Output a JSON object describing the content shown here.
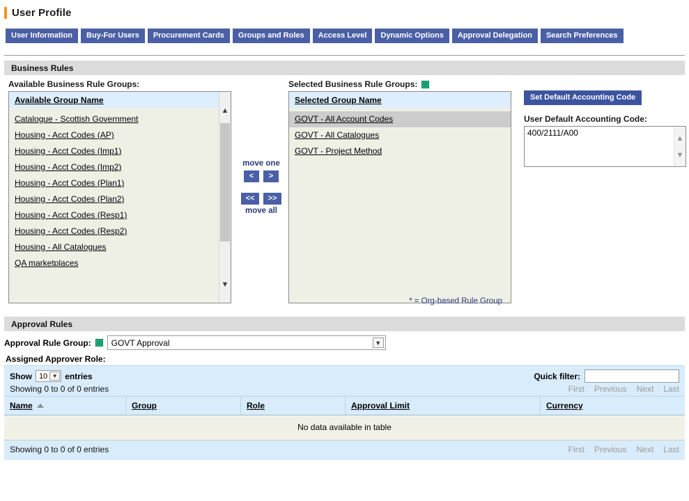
{
  "header": {
    "title": "User Profile"
  },
  "tabs": [
    {
      "label": "User Information"
    },
    {
      "label": "Buy-For Users"
    },
    {
      "label": "Procurement Cards"
    },
    {
      "label": "Groups and Roles"
    },
    {
      "label": "Access Level"
    },
    {
      "label": "Dynamic Options"
    },
    {
      "label": "Approval Delegation"
    },
    {
      "label": "Search Preferences"
    }
  ],
  "business_rules": {
    "section_title": "Business Rules",
    "available_label": "Available Business Rule Groups:",
    "available_header": "Available Group Name",
    "available_items": [
      "Catalogue - Scottish Government",
      "Housing - Acct Codes (AP)",
      "Housing - Acct Codes (Imp1)",
      "Housing - Acct Codes (Imp2)",
      "Housing - Acct Codes (Plan1)",
      "Housing - Acct Codes (Plan2)",
      "Housing - Acct Codes (Resp1)",
      "Housing - Acct Codes (Resp2)",
      "Housing - All Catalogues",
      "QA marketplaces"
    ],
    "selected_label": "Selected Business Rule Groups:",
    "selected_header": "Selected Group Name",
    "selected_items": [
      {
        "label": "GOVT - All Account Codes",
        "selected": true
      },
      {
        "label": "GOVT - All Catalogues",
        "selected": false
      },
      {
        "label": "GOVT - Project Method",
        "selected": false
      }
    ],
    "move_one_label": "move one",
    "move_all_label": "move all",
    "move_left_one": "<",
    "move_right_one": ">",
    "move_left_all": "<<",
    "move_right_all": ">>",
    "set_default_button": "Set Default Accounting Code",
    "default_code_label": "User Default Accounting Code:",
    "default_code_value": "400/2111/A00",
    "org_note": "* = Org-based Rule Group"
  },
  "approval_rules": {
    "section_title": "Approval Rules",
    "group_label": "Approval Rule Group:",
    "group_value": "GOVT Approval",
    "assigned_label": "Assigned Approver Role:",
    "show_label": "Show",
    "show_value": "10",
    "entries_label": "entries",
    "filter_label": "Quick filter:",
    "filter_value": "",
    "info_top": "Showing 0 to 0 of 0 entries",
    "info_bottom": "Showing 0 to 0 of 0 entries",
    "pager": [
      "First",
      "Previous",
      "Next",
      "Last"
    ],
    "columns": [
      "Name",
      "Group",
      "Role",
      "Approval Limit",
      "Currency"
    ],
    "empty_message": "No data available in table"
  },
  "colors": {
    "tab_blue": "#4a5fa5",
    "accent_orange": "#f0941e",
    "required_green": "#0f9e6e",
    "table_blue": "#d9ecfb",
    "section_gray": "#dcdcdc",
    "navy_text": "#2b3a78"
  }
}
